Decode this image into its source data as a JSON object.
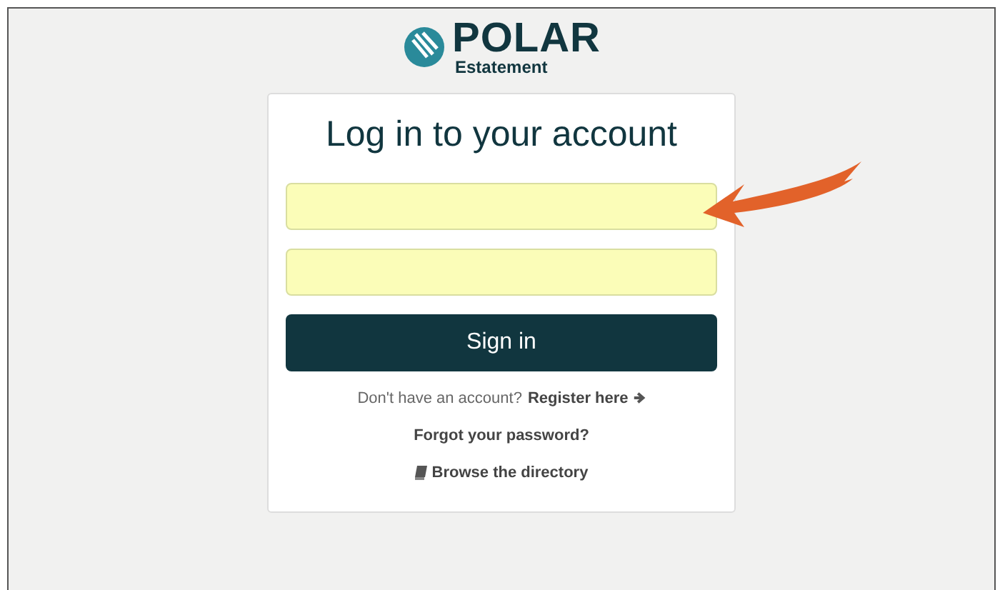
{
  "logo": {
    "name": "POLAR",
    "tagline": "Estatement"
  },
  "form": {
    "title": "Log in to your account",
    "fields": [
      {
        "autofilled": true
      },
      {
        "autofilled": true
      }
    ],
    "submit": "Sign in",
    "register_prompt": "Don't have an account?",
    "register_link": "Register here",
    "forgot_link": "Forgot your password?",
    "directory_link": "Browse the directory"
  },
  "annotation": {
    "kind": "arrow"
  }
}
